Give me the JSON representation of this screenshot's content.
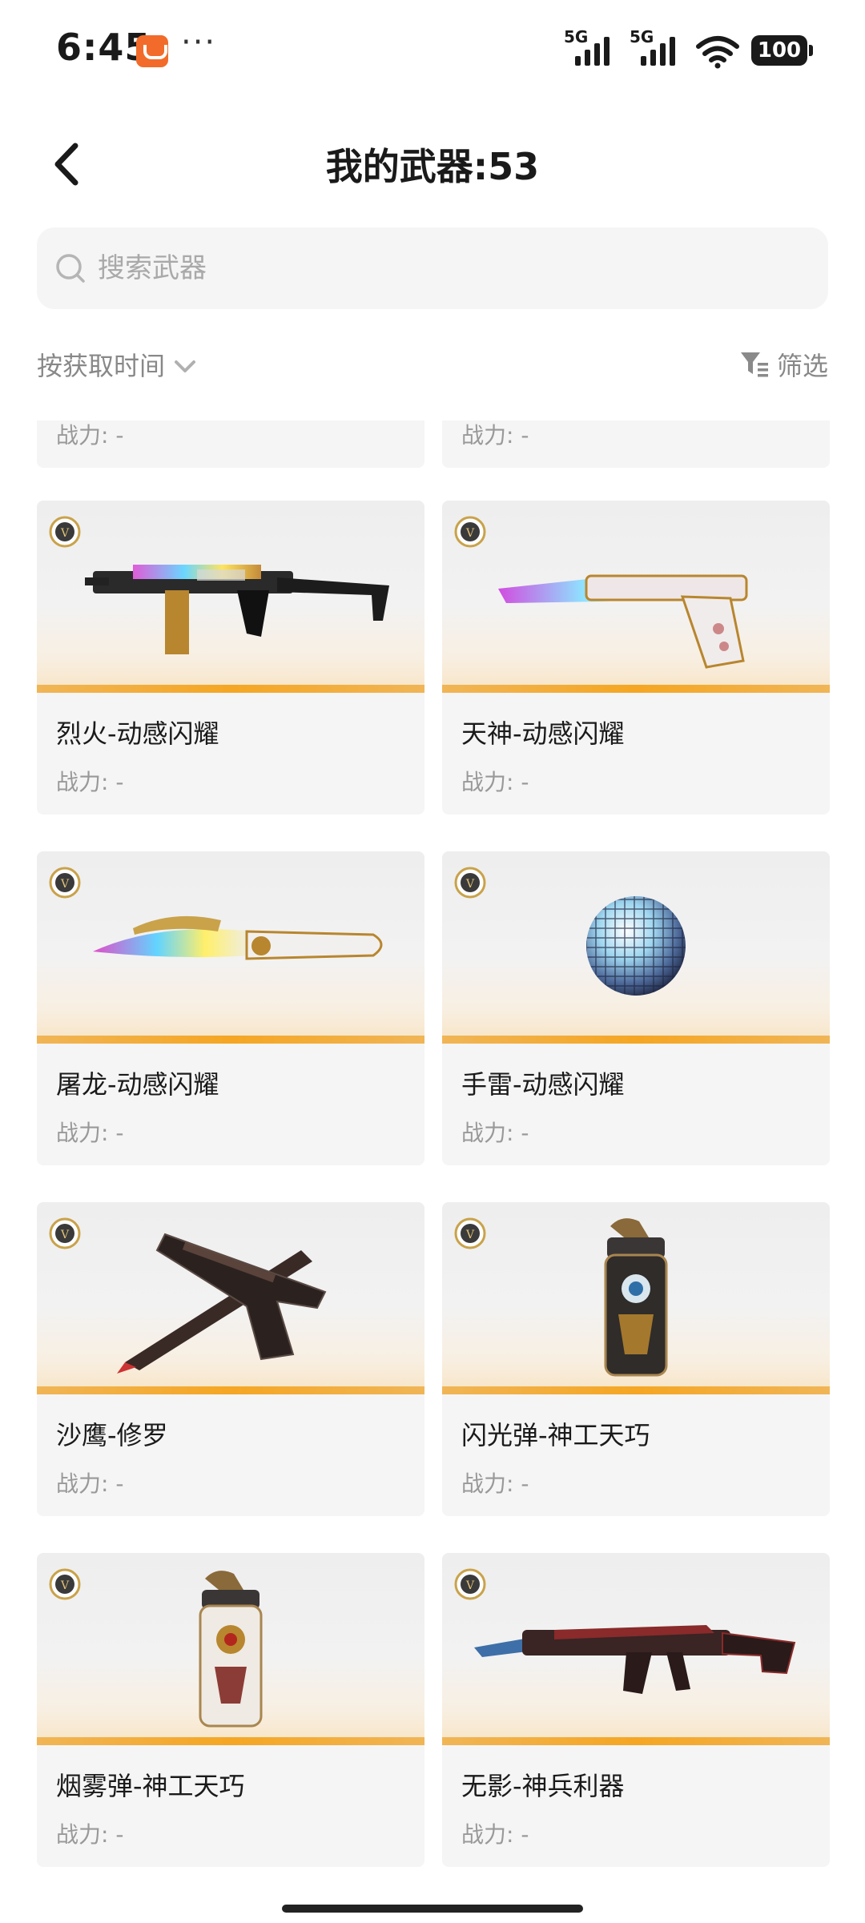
{
  "status_bar": {
    "time": "6:45",
    "battery": "100",
    "signal1": "5G",
    "signal2": "5G",
    "more_dots": "···"
  },
  "header": {
    "title": "我的武器:53"
  },
  "search": {
    "placeholder": "搜索武器"
  },
  "toolbar": {
    "sort_label": "按获取时间",
    "filter_label": "筛选"
  },
  "partial_row": [
    {
      "power": "战力: -"
    },
    {
      "power": "战力: -"
    }
  ],
  "weapons": [
    {
      "name": "烈火-动感闪耀",
      "power": "战力: -",
      "icon": "smg-icon"
    },
    {
      "name": "天神-动感闪耀",
      "power": "战力: -",
      "icon": "pistol-icon"
    },
    {
      "name": "屠龙-动感闪耀",
      "power": "战力: -",
      "icon": "knife-icon"
    },
    {
      "name": "手雷-动感闪耀",
      "power": "战力: -",
      "icon": "disco-grenade-icon"
    },
    {
      "name": "沙鹰-修罗",
      "power": "战力: -",
      "icon": "pistol-knife-icon"
    },
    {
      "name": "闪光弹-神工天巧",
      "power": "战力: -",
      "icon": "flashbang-icon"
    },
    {
      "name": "烟雾弹-神工天巧",
      "power": "战力: -",
      "icon": "smoke-grenade-icon"
    },
    {
      "name": "无影-神兵利器",
      "power": "战力: -",
      "icon": "rifle-icon"
    }
  ],
  "colors": {
    "accent_stripe": "#f5a623",
    "badge_gold": "#c9a24a"
  }
}
